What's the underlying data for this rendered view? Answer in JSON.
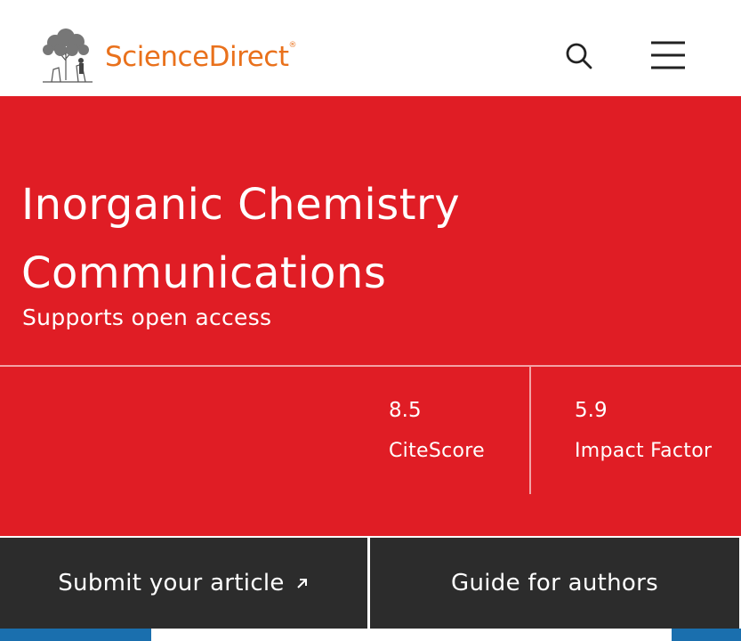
{
  "header": {
    "brand_name": "ScienceDirect",
    "brand_mark": "®",
    "logo_icon": "elsevier-tree-icon",
    "search_icon": "search-icon",
    "menu_icon": "hamburger-menu-icon"
  },
  "journal": {
    "title": "Inorganic Chemistry Communications",
    "access": "Supports open access"
  },
  "metrics": [
    {
      "value": "8.5",
      "label": "CiteScore"
    },
    {
      "value": "5.9",
      "label": "Impact Factor"
    }
  ],
  "actions": {
    "submit_label": "Submit your article",
    "submit_icon": "external-arrow-icon",
    "guide_label": "Guide for authors"
  },
  "colors": {
    "brand_red": "#e01d25",
    "brand_orange": "#e9711c",
    "button_dark": "#2c2c2c",
    "link_blue": "#1a6fae"
  }
}
